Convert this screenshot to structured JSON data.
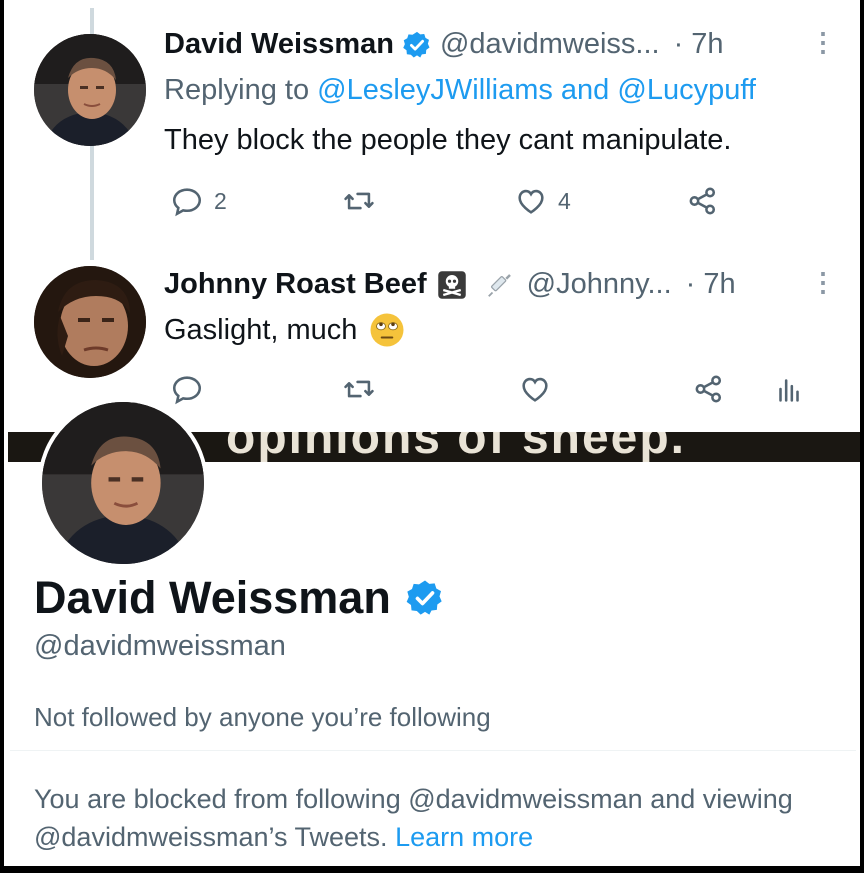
{
  "tweets": [
    {
      "name": "David Weissman",
      "handle": "@davidmweiss...",
      "time": "· 7h",
      "replying_prefix": "Replying to",
      "replying_user1": "@LesleyJWilliams",
      "replying_and": "and",
      "replying_user2": "@Lucypuff",
      "text": "They block the people they cant manipulate.",
      "reply_count": "2",
      "like_count": "4"
    },
    {
      "name": "Johnny Roast Beef",
      "handle": "@Johnny...",
      "time": "· 7h",
      "text": "Gaslight, much"
    }
  ],
  "profile": {
    "banner_text": "opinions of sheep.",
    "name": "David Weissman",
    "handle": "@davidmweissman",
    "follow_status": "Not followed by anyone you’re following",
    "blocked_text": "You are blocked from following @davidmweissman and viewing @davidmweissman’s Tweets.",
    "learn_more": "Learn more"
  },
  "colors": {
    "accent": "#1d9bf0",
    "secondary_text": "#536471",
    "primary_text": "#0f1419"
  },
  "icons": [
    "reply-icon",
    "retweet-icon",
    "like-icon",
    "share-icon",
    "analytics-icon",
    "verified-badge-icon",
    "more-options-icon",
    "skull-crossbones-emoji",
    "syringe-emoji",
    "eye-roll-emoji"
  ]
}
